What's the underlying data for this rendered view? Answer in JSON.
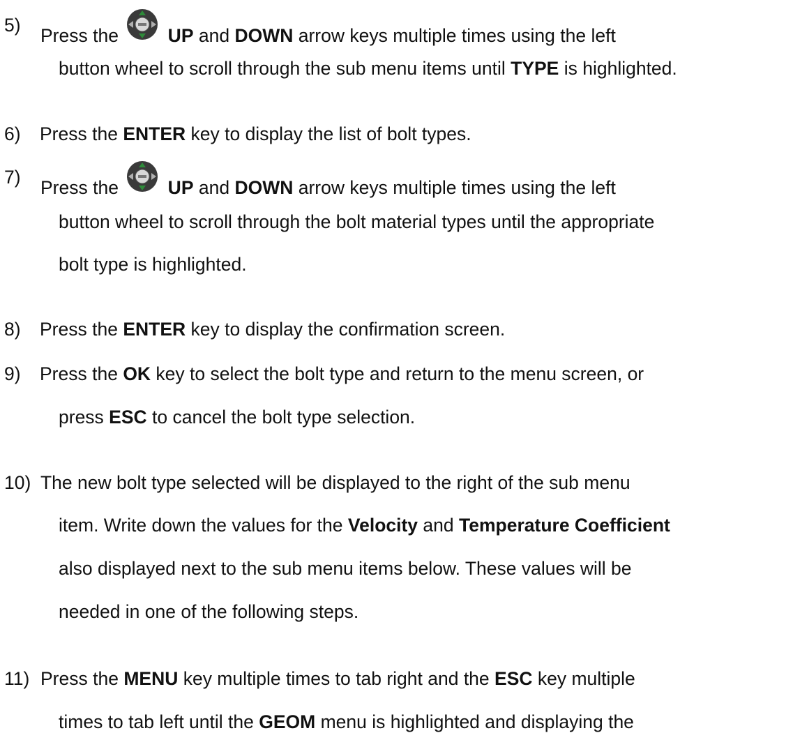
{
  "steps": [
    {
      "number": "5)",
      "lines": [
        {
          "parts": [
            {
              "t": "Press the ",
              "b": false
            },
            {
              "icon": "button-wheel-icon"
            },
            {
              "t": " UP",
              "b": true
            },
            {
              "t": " and ",
              "b": false
            },
            {
              "t": "DOWN",
              "b": true
            },
            {
              "t": " arrow keys multiple times using the left",
              "b": false
            }
          ]
        },
        {
          "parts": [
            {
              "t": "button wheel to scroll through the sub menu items until ",
              "b": false
            },
            {
              "t": "TYPE",
              "b": true
            },
            {
              "t": " is highlighted.",
              "b": false
            }
          ]
        }
      ]
    },
    {
      "number": "6)",
      "lines": [
        {
          "parts": [
            {
              "t": " Press the ",
              "b": false
            },
            {
              "t": "ENTER",
              "b": true
            },
            {
              "t": " key to display the list of bolt types.",
              "b": false
            }
          ]
        }
      ]
    },
    {
      "number": "7)",
      "lines": [
        {
          "parts": [
            {
              "t": "Press the ",
              "b": false
            },
            {
              "icon": "button-wheel-icon"
            },
            {
              "t": " UP",
              "b": true
            },
            {
              "t": " and ",
              "b": false
            },
            {
              "t": "DOWN",
              "b": true
            },
            {
              "t": " arrow keys multiple times using the left",
              "b": false
            }
          ]
        },
        {
          "parts": [
            {
              "t": "button wheel to scroll through the bolt material types until the appropriate",
              "b": false
            }
          ]
        },
        {
          "parts": [
            {
              "t": "bolt type is highlighted.",
              "b": false
            }
          ]
        }
      ]
    },
    {
      "number": "8)",
      "lines": [
        {
          "parts": [
            {
              "t": " Press the ",
              "b": false
            },
            {
              "t": "ENTER",
              "b": true
            },
            {
              "t": " key to display the confirmation screen.",
              "b": false
            }
          ]
        }
      ]
    },
    {
      "number": "9)",
      "lines": [
        {
          "parts": [
            {
              "t": " Press the ",
              "b": false
            },
            {
              "t": "OK",
              "b": true
            },
            {
              "t": " key to select the bolt type and return to the menu screen, or",
              "b": false
            }
          ]
        },
        {
          "parts": [
            {
              "t": "press ",
              "b": false
            },
            {
              "t": "ESC",
              "b": true
            },
            {
              "t": " to cancel the bolt type selection.",
              "b": false
            }
          ]
        }
      ]
    },
    {
      "number": "10)",
      "lines": [
        {
          "parts": [
            {
              "t": "The new bolt type selected will be displayed to the right of the sub menu",
              "b": false
            }
          ]
        },
        {
          "parts": [
            {
              "t": "item.  Write down the values for the ",
              "b": false
            },
            {
              "t": "Velocity",
              "b": true
            },
            {
              "t": " and ",
              "b": false
            },
            {
              "t": "Temperature Coefficient",
              "b": true
            }
          ]
        },
        {
          "parts": [
            {
              "t": "also displayed next to the sub menu items below.  These values will be",
              "b": false
            }
          ]
        },
        {
          "parts": [
            {
              "t": "needed in one of the following steps.",
              "b": false
            }
          ]
        }
      ]
    },
    {
      "number": "11)",
      "lines": [
        {
          "parts": [
            {
              "t": "Press the ",
              "b": false
            },
            {
              "t": "MENU",
              "b": true
            },
            {
              "t": " key multiple times to tab right and the ",
              "b": false
            },
            {
              "t": "ESC",
              "b": true
            },
            {
              "t": " key multiple",
              "b": false
            }
          ]
        },
        {
          "parts": [
            {
              "t": "times to tab left until the ",
              "b": false
            },
            {
              "t": "GEOM",
              "b": true
            },
            {
              "t": " menu is highlighted and displaying the",
              "b": false
            }
          ]
        }
      ]
    }
  ],
  "icon_colors": {
    "wheel_outer": "#3a3a3a",
    "wheel_center": "#d8d8d8",
    "arrow_up": "#2e8b3a",
    "arrow_down": "#2e8b3a",
    "arrow_side": "#b0b0b0"
  }
}
